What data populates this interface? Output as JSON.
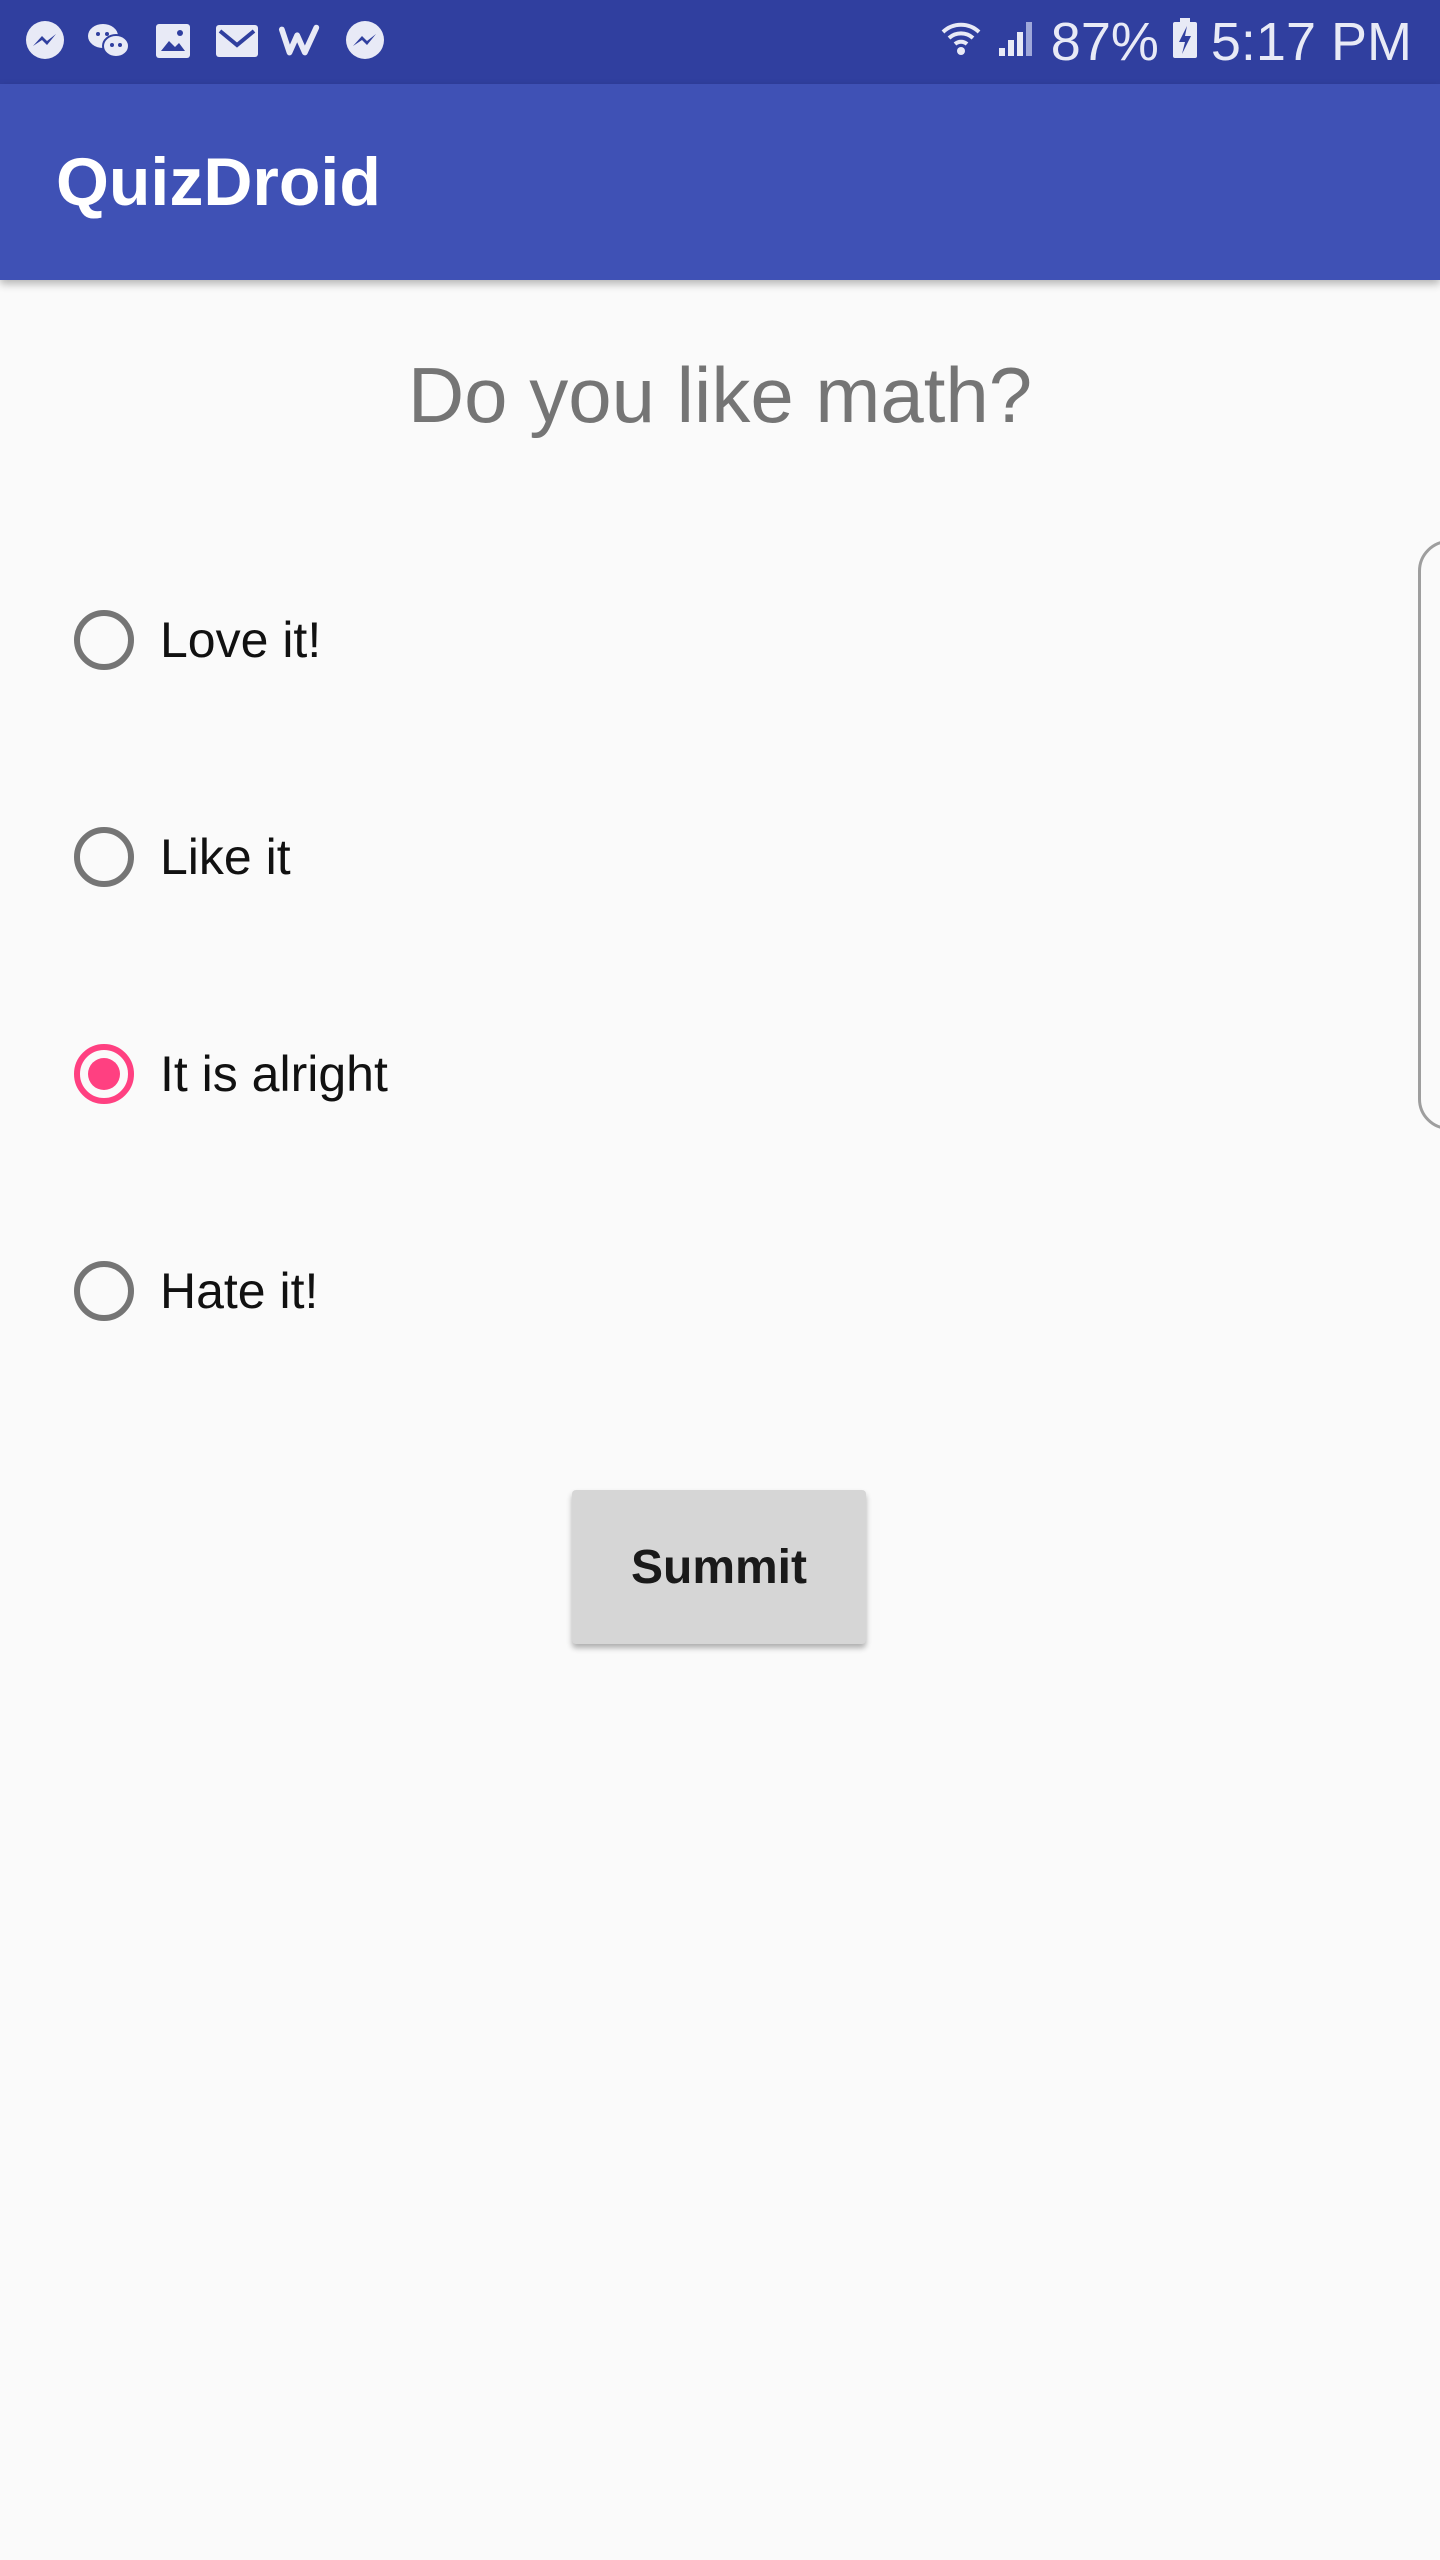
{
  "status_bar": {
    "notification_icons": [
      "messenger-icon",
      "wechat-icon",
      "gallery-icon",
      "email-icon",
      "wattpad-icon",
      "messenger-icon"
    ],
    "battery_percent": "87%",
    "time": "5:17 PM"
  },
  "app_bar": {
    "title": "QuizDroid"
  },
  "quiz": {
    "question": "Do you like math?",
    "options": [
      {
        "label": "Love it!",
        "checked": false
      },
      {
        "label": "Like it",
        "checked": false
      },
      {
        "label": "It is alright",
        "checked": true
      },
      {
        "label": "Hate it!",
        "checked": false
      }
    ],
    "submit_label": "Summit"
  },
  "colors": {
    "status_bar": "#303f9f",
    "primary": "#3f51b5",
    "accent": "#ff4081",
    "background": "#fafafa"
  }
}
